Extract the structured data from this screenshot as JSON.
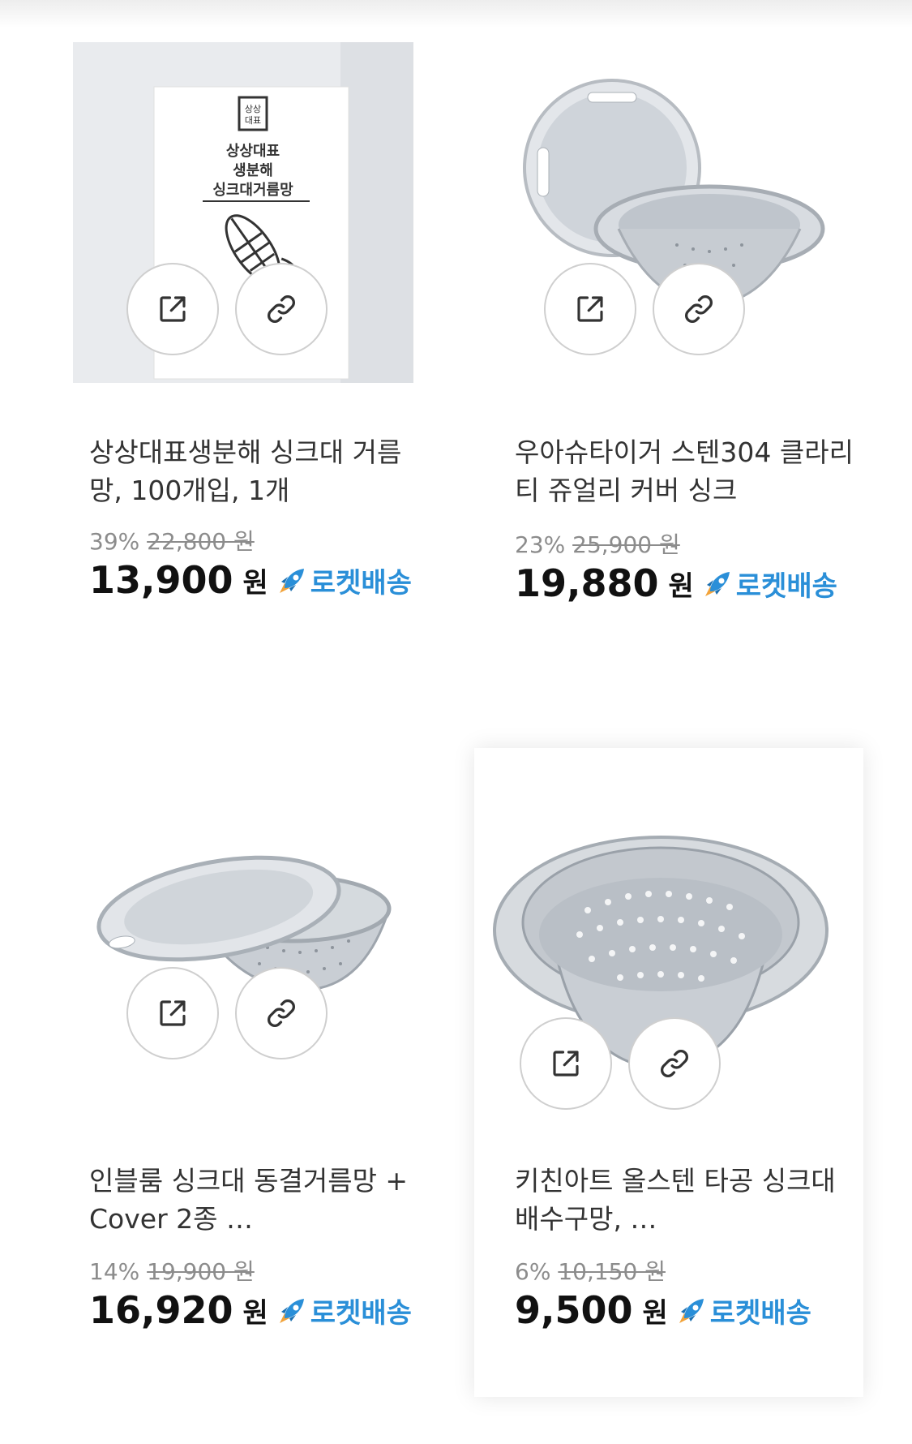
{
  "products": [
    {
      "title": "상상대표생분해 싱크대 거름망, 100개입, 1개",
      "discount": "39%",
      "original_price": "22,800 원",
      "price": "13,900",
      "currency": "원",
      "delivery": "로켓배송",
      "box_text": {
        "logo": "상상\n대표",
        "line1": "상상대표",
        "line2": "생분해",
        "line3": "싱크대거름망"
      }
    },
    {
      "title": "우아슈타이거 스텐304 클라리티 쥬얼리 커버 싱크",
      "discount": "23%",
      "original_price": "25,900 원",
      "price": "19,880",
      "currency": "원",
      "delivery": "로켓배송"
    },
    {
      "title": "인블룸 싱크대 동결거름망 + Cover 2종 …",
      "discount": "14%",
      "original_price": "19,900 원",
      "price": "16,920",
      "currency": "원",
      "delivery": "로켓배송"
    },
    {
      "title": "키친아트 올스텐 타공 싱크대 배수구망, …",
      "discount": "6%",
      "original_price": "10,150 원",
      "price": "9,500",
      "currency": "원",
      "delivery": "로켓배송"
    }
  ],
  "icons": {
    "open": "external-link-icon",
    "copy": "link-icon",
    "delivery": "rocket-icon"
  },
  "colors": {
    "rocket_blue": "#2a8fd8",
    "price": "#111111",
    "muted": "#8c8c8c"
  }
}
